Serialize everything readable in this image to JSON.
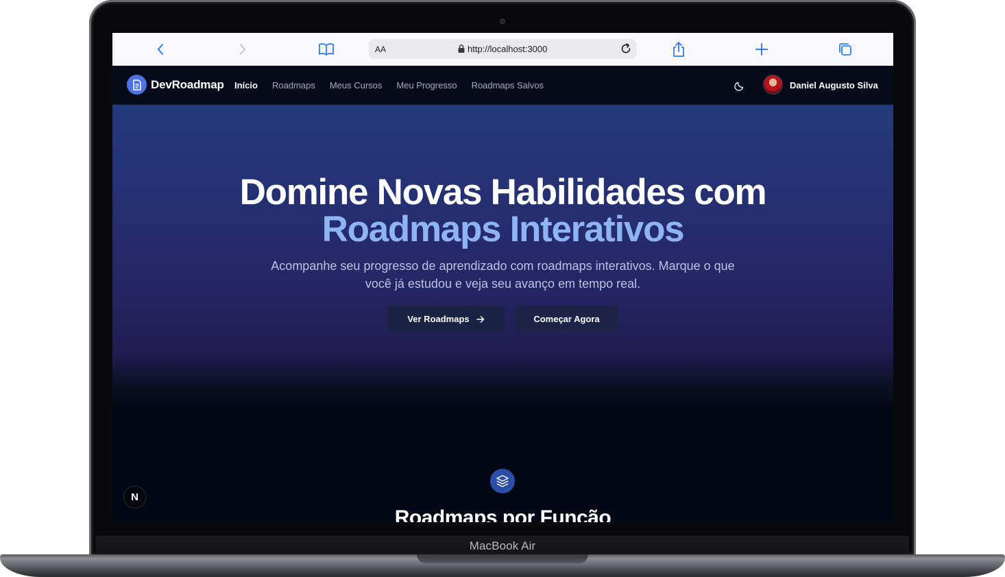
{
  "device": {
    "label": "MacBook Air"
  },
  "browser": {
    "reader_label": "AA",
    "url": "http://localhost:3000"
  },
  "navbar": {
    "brand": "DevRoadmap",
    "links": [
      {
        "label": "Início",
        "active": true
      },
      {
        "label": "Roadmaps",
        "active": false
      },
      {
        "label": "Meus Cursos",
        "active": false
      },
      {
        "label": "Meu Progresso",
        "active": false
      },
      {
        "label": "Roadmaps Salvos",
        "active": false
      }
    ],
    "user_name": "Daniel Augusto Silva"
  },
  "hero": {
    "title_line1": "Domine Novas Habilidades com",
    "title_line2": "Roadmaps Interativos",
    "subtitle": "Acompanhe seu progresso de aprendizado com roadmaps interativos. Marque o que você já estudou e veja seu avanço em tempo real.",
    "primary_button": "Ver Roadmaps",
    "secondary_button": "Começar Agora"
  },
  "section": {
    "title": "Roadmaps por Função"
  },
  "dev_badge": {
    "label": "N"
  },
  "icons": {
    "back": "chevron-left-icon",
    "forward": "chevron-right-icon",
    "bookmarks": "book-icon",
    "lock": "lock-icon",
    "reload": "reload-icon",
    "share": "share-icon",
    "new_tab": "plus-icon",
    "tabs": "tabs-icon",
    "logo": "document-icon",
    "theme": "moon-icon",
    "arrow": "arrow-right-icon",
    "layers": "layers-icon"
  },
  "colors": {
    "accent": "#8fb4f5",
    "brand_badge": "#4d72e6",
    "navbar_bg": "#060b1a",
    "safari_blue": "#2f7cf6"
  }
}
